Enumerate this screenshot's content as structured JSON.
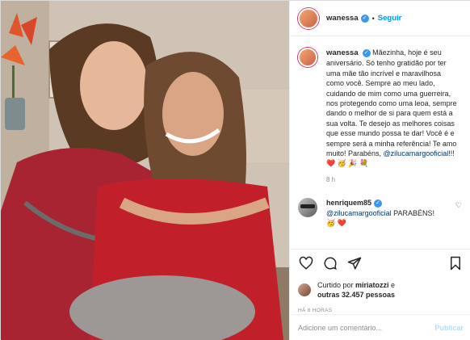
{
  "header": {
    "username": "wanessa",
    "follow_label": "Seguir",
    "dot": "•"
  },
  "caption": {
    "username": "wanessa",
    "text": "Mãezinha, hoje é seu aniversário. Só tenho gratidão por ter uma mãe tão incrível e maravilhosa como você. Sempre ao meu lado, cuidando de mim como uma guerreira, nos protegendo como uma leoa, sempre dando o melhor de si para quem está a sua volta. Te desejo as melhores coisas que esse mundo possa te dar! Você é e sempre será a minha referência! Te amo muito! Parabéns, ",
    "mention": "@zilucamargooficial",
    "suffix": "!!! ❤️ 🥳 🎉 💐",
    "time": "8 h"
  },
  "comment": {
    "username": "henriquem85",
    "mention": "@zilucamargooficial",
    "text": " PARABÉNS!",
    "emojis": "🥳 ❤️"
  },
  "likes": {
    "prefix": "Curtido por ",
    "user": "miriatozzi",
    "middle": " e",
    "others": "outras 32.457 pessoas"
  },
  "post_time": "HÁ 8 HORAS",
  "add_comment": {
    "placeholder": "Adicione um comentário...",
    "publish_label": "Publicar"
  },
  "icons": {
    "like": "heart-icon",
    "comment": "comment-icon",
    "share": "share-icon",
    "save": "bookmark-icon"
  }
}
